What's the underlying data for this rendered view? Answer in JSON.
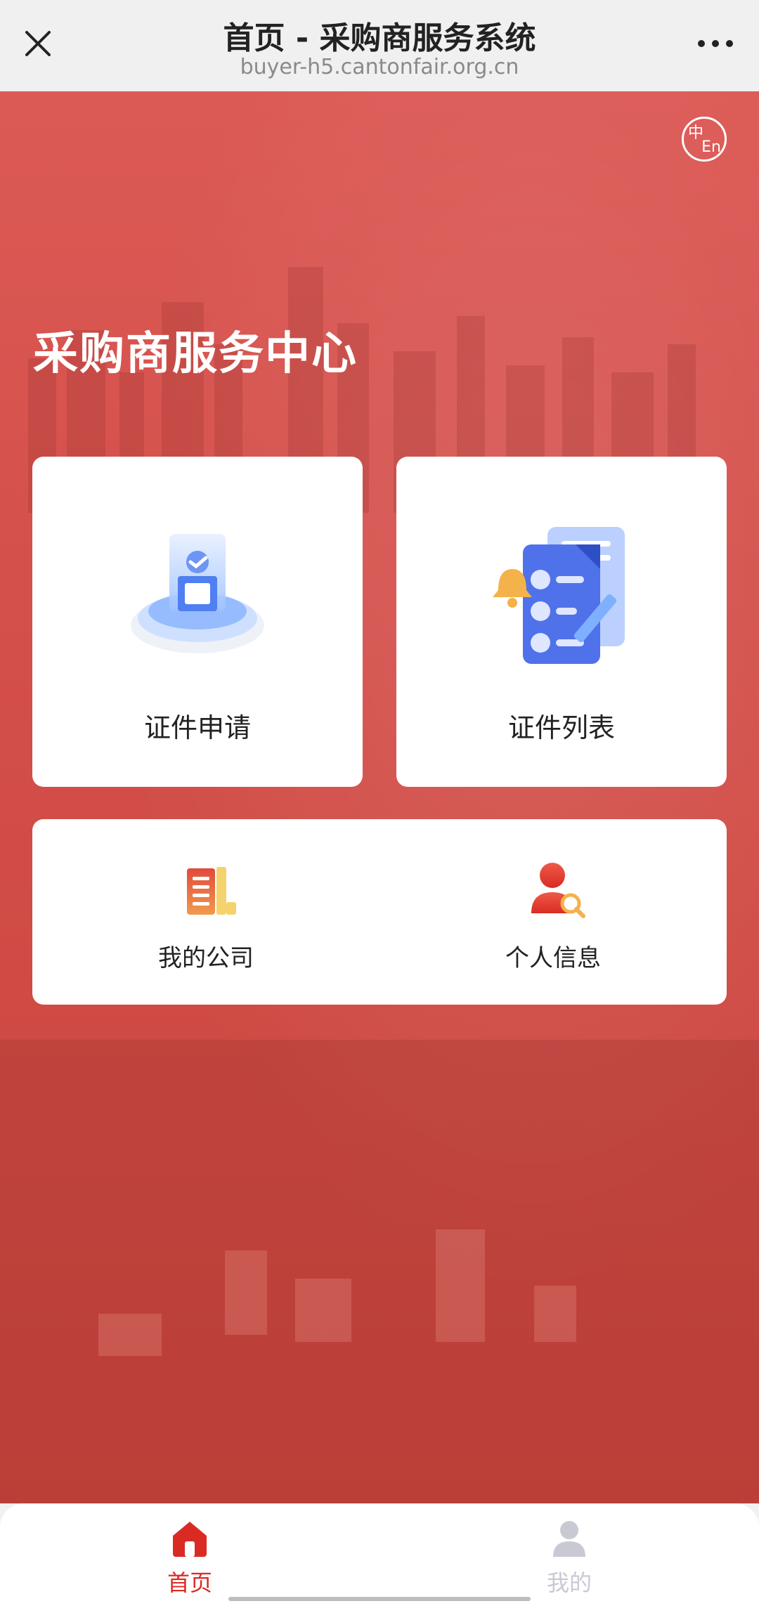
{
  "topbar": {
    "title": "首页 - 采购商服务系统",
    "url": "buyer-h5.cantonfair.org.cn",
    "close_icon": "close-icon",
    "more_icon": "more-dots-icon"
  },
  "lang_switch": {
    "zh": "中",
    "en": "En"
  },
  "hero": {
    "title": "采购商服务中心"
  },
  "cards": {
    "apply": {
      "label": "证件申请",
      "icon": "certificate-cube-illustration"
    },
    "list": {
      "label": "证件列表",
      "icon": "document-list-illustration"
    },
    "company": {
      "label": "我的公司",
      "icon": "building-icon"
    },
    "profile": {
      "label": "个人信息",
      "icon": "user-search-icon"
    }
  },
  "bottom_nav": {
    "home": {
      "label": "首页",
      "icon": "home-icon"
    },
    "mine": {
      "label": "我的",
      "icon": "user-icon"
    }
  },
  "colors": {
    "brand_red": "#d92b24",
    "hero_bg": "#d5514c",
    "inactive_nav": "#c9c9d3"
  }
}
